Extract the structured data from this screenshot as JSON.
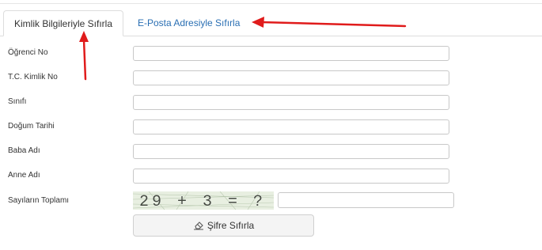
{
  "tabs": [
    {
      "label": "Kimlik Bilgileriyle Sıfırla",
      "active": true
    },
    {
      "label": "E-Posta Adresiyle Sıfırla",
      "active": false
    }
  ],
  "form": {
    "fields": [
      {
        "label": "Öğrenci No",
        "value": ""
      },
      {
        "label": "T.C. Kimlik No",
        "value": ""
      },
      {
        "label": "Sınıfı",
        "value": ""
      },
      {
        "label": "Doğum Tarihi",
        "value": ""
      },
      {
        "label": "Baba Adı",
        "value": ""
      },
      {
        "label": "Anne Adı",
        "value": ""
      }
    ],
    "captcha": {
      "label": "Sayıların Toplamı",
      "image_text": "29 + 3 = ?",
      "value": ""
    },
    "submit_label": "Şifre Sıfırla",
    "submit_icon": "eraser-icon"
  },
  "colors": {
    "tab_link": "#2a6fb3",
    "annotation_red": "#e01b1b",
    "input_border": "#c8c8c8",
    "button_bg": "#f4f4f4"
  }
}
